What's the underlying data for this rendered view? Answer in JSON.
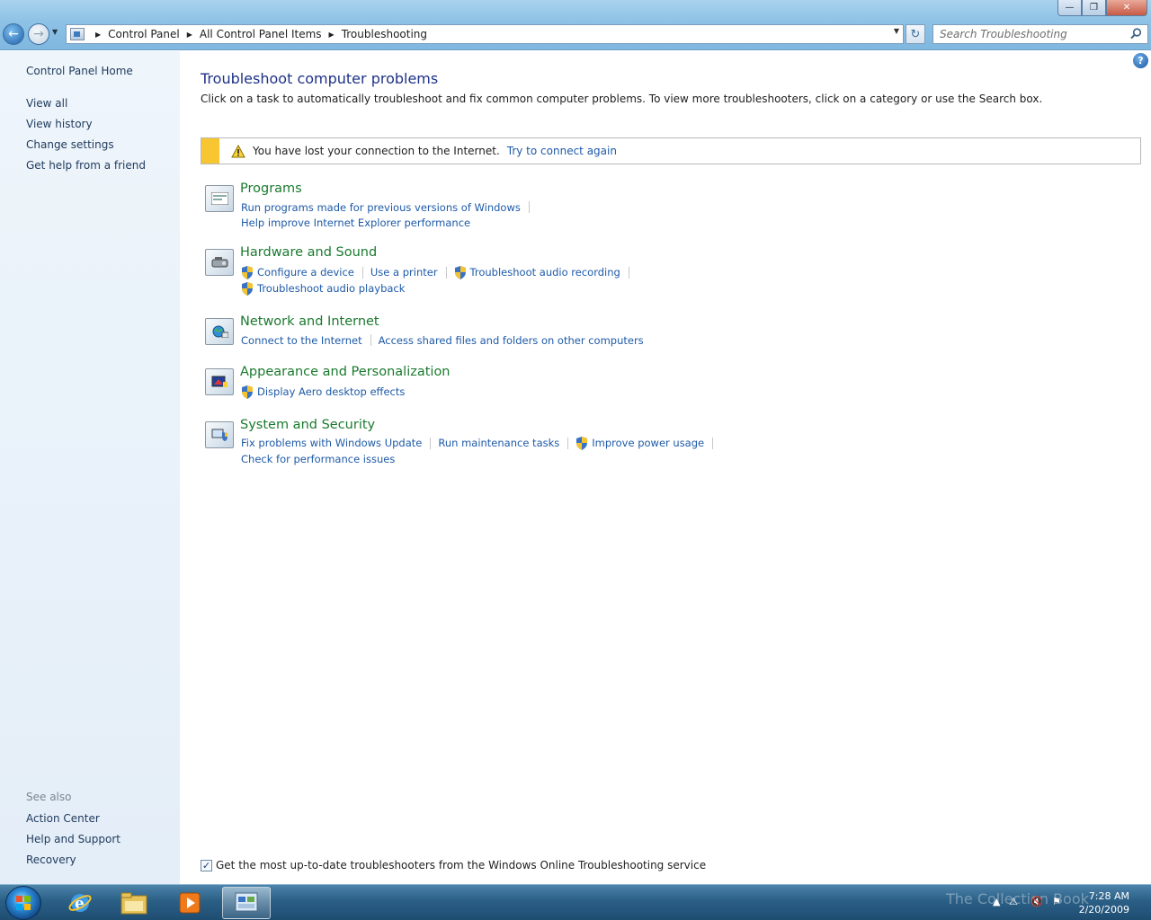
{
  "window": {
    "minimize": "—",
    "maximize": "❐",
    "close": "✕"
  },
  "address": {
    "crumbs": [
      "Control Panel",
      "All Control Panel Items",
      "Troubleshooting"
    ],
    "search_placeholder": "Search Troubleshooting"
  },
  "sidebar": {
    "home": "Control Panel Home",
    "items": [
      "View all",
      "View history",
      "Change settings",
      "Get help from a friend"
    ],
    "see_also_label": "See also",
    "see_also": [
      "Action Center",
      "Help and Support",
      "Recovery"
    ]
  },
  "main": {
    "title": "Troubleshoot computer problems",
    "description": "Click on a task to automatically troubleshoot and fix common computer problems. To view more troubleshooters, click on a category or use the Search box.",
    "infobar": {
      "message": "You have lost your connection to the Internet.",
      "link": "Try to connect again",
      "accent": "#f8c631"
    },
    "categories": [
      {
        "title": "Programs",
        "icon": "programs-icon",
        "rows": [
          [
            {
              "label": "Run programs made for previous versions of Windows",
              "shield": false
            }
          ],
          [
            {
              "label": "Help improve Internet Explorer performance",
              "shield": false
            }
          ]
        ]
      },
      {
        "title": "Hardware and Sound",
        "icon": "hardware-sound-icon",
        "rows": [
          [
            {
              "label": "Configure a device",
              "shield": true
            },
            {
              "label": "Use a printer",
              "shield": false
            },
            {
              "label": "Troubleshoot audio recording",
              "shield": true
            }
          ],
          [
            {
              "label": "Troubleshoot audio playback",
              "shield": true
            }
          ]
        ]
      },
      {
        "title": "Network and Internet",
        "icon": "network-icon",
        "rows": [
          [
            {
              "label": "Connect to the Internet",
              "shield": false
            },
            {
              "label": "Access shared files and folders on other computers",
              "shield": false
            }
          ]
        ]
      },
      {
        "title": "Appearance and Personalization",
        "icon": "appearance-icon",
        "rows": [
          [
            {
              "label": "Display Aero desktop effects",
              "shield": true
            }
          ]
        ]
      },
      {
        "title": "System and Security",
        "icon": "system-security-icon",
        "rows": [
          [
            {
              "label": "Fix problems with Windows Update",
              "shield": false
            },
            {
              "label": "Run maintenance tasks",
              "shield": false
            },
            {
              "label": "Improve power usage",
              "shield": true
            }
          ],
          [
            {
              "label": "Check for performance issues",
              "shield": false
            }
          ]
        ]
      }
    ],
    "footer_checkbox": {
      "checked": true,
      "label": "Get the most up-to-date troubleshooters from the Windows Online Troubleshooting service"
    }
  },
  "taskbar": {
    "watermark": "The Collection Book",
    "time": "7:28 AM",
    "date": "2/20/2009"
  },
  "colors": {
    "link": "#1e5aa8",
    "category": "#1a7a2e",
    "title": "#1e3287"
  }
}
